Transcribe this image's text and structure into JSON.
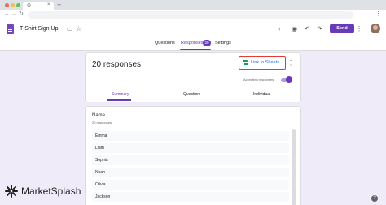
{
  "browser": {
    "tab_glyph": "⊕",
    "tab_close": "×",
    "new_tab": "+",
    "nav": {
      "back": "←",
      "forward": "→",
      "reload": "↻"
    },
    "menu": "⋮",
    "dots": [
      "#ed6a5e",
      "#f5bf4f",
      "#61c554"
    ]
  },
  "header": {
    "title": "T-Shirt Sign Up",
    "icons": {
      "folder": "▭",
      "star": "☆",
      "palette": "◐",
      "preview": "◉",
      "undo": "↶",
      "redo": "↷",
      "more": "⋮"
    },
    "send_label": "Send",
    "accent": "#673ab7"
  },
  "tabs": {
    "questions": "Questions",
    "responses": "Responses",
    "responses_count": "20",
    "settings": "Settings"
  },
  "summary": {
    "count": "20 responses",
    "link_label": "Link to Sheets",
    "accepting_label": "Accepting responses",
    "accepting": true,
    "views": [
      "Summary",
      "Question",
      "Individual"
    ]
  },
  "question": {
    "title": "Name",
    "subtitle": "20 responses",
    "answers": [
      "Emma",
      "Liam",
      "Sophia",
      "Noah",
      "Olivia",
      "Jackson"
    ]
  },
  "watermark": {
    "brand": "MarketSplash"
  },
  "help": "?"
}
